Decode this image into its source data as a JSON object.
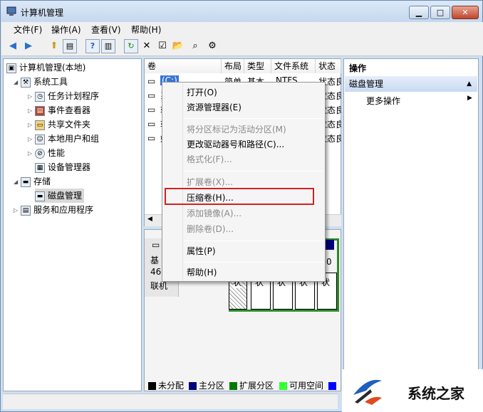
{
  "window": {
    "title": "计算机管理",
    "min": "▁",
    "max": "□",
    "close": "✕"
  },
  "menu": [
    "文件(F)",
    "操作(A)",
    "查看(V)",
    "帮助(H)"
  ],
  "tree": {
    "root": "计算机管理(本地)",
    "system_tools": "系统工具",
    "task_scheduler": "任务计划程序",
    "event_viewer": "事件查看器",
    "shared_folders": "共享文件夹",
    "local_users": "本地用户和组",
    "performance": "性能",
    "device_manager": "设备管理器",
    "storage": "存储",
    "disk_mgmt": "磁盘管理",
    "services": "服务和应用程序"
  },
  "volume_table": {
    "headers": [
      "卷",
      "布局",
      "类型",
      "文件系统",
      "状态"
    ],
    "row1": {
      "volume": "(C:)",
      "layout": "简单",
      "type": "基本",
      "fs": "NTFS",
      "status": "状态良"
    },
    "partial_rows": [
      "状态良",
      "状态良",
      "状态良",
      "状态良"
    ],
    "partial_left": [
      "系",
      "软",
      "软",
      "娱"
    ]
  },
  "disk_panel": {
    "label1": "基",
    "label2": "46",
    "label3": "联机",
    "num": "0",
    "status_cells": [
      "状",
      "状",
      "状",
      "状",
      "状"
    ]
  },
  "context_menu": {
    "open": "打开(O)",
    "explorer": "资源管理器(E)",
    "mark_active": "将分区标记为活动分区(M)",
    "change_letter": "更改驱动器号和路径(C)...",
    "format": "格式化(F)...",
    "extend": "扩展卷(X)...",
    "shrink": "压缩卷(H)...",
    "add_mirror": "添加镜像(A)...",
    "delete": "删除卷(D)...",
    "properties": "属性(P)",
    "help": "帮助(H)"
  },
  "legend": [
    {
      "label": "未分配",
      "color": "#000000"
    },
    {
      "label": "主分区",
      "color": "#00007b"
    },
    {
      "label": "扩展分区",
      "color": "#007b00"
    },
    {
      "label": "可用空间",
      "color": "#33ff33"
    },
    {
      "label": "",
      "color": "#0000ff"
    }
  ],
  "actions": {
    "header": "操作",
    "section": "磁盘管理",
    "more": "更多操作"
  },
  "watermark": "系统之家",
  "colors": {
    "highlight_border": "#d42020",
    "accent": "#1f5fbf"
  }
}
